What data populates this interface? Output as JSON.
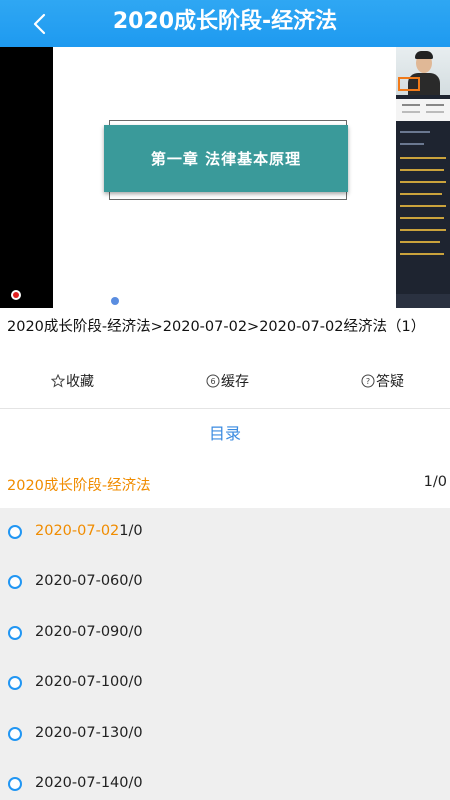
{
  "header": {
    "title": "2020成长阶段-经济法",
    "back_icon": "chevron-left-icon"
  },
  "video": {
    "slide_title": "第一章  法律基本原理",
    "accent": "#3a9a9a"
  },
  "breadcrumb": "2020成长阶段-经济法>2020-07-02>2020-07-02经济法（1）",
  "actions": {
    "favorite": "收藏",
    "cache": "缓存",
    "question": "答疑"
  },
  "catalog": {
    "title": "目录",
    "chapter": {
      "name": "2020成长阶段-经济法",
      "count": "1/0"
    },
    "lessons": [
      {
        "date": "2020-07-02",
        "count": "1/0",
        "active": true
      },
      {
        "date": "2020-07-06",
        "count": "0/0",
        "active": false
      },
      {
        "date": "2020-07-09",
        "count": "0/0",
        "active": false
      },
      {
        "date": "2020-07-10",
        "count": "0/0",
        "active": false
      },
      {
        "date": "2020-07-13",
        "count": "0/0",
        "active": false
      },
      {
        "date": "2020-07-14",
        "count": "0/0",
        "active": false
      }
    ]
  },
  "colors": {
    "header": "#1e9af0",
    "active_text": "#f08c00",
    "catalog_title": "#3b8be0",
    "ring": "#2196f3"
  }
}
